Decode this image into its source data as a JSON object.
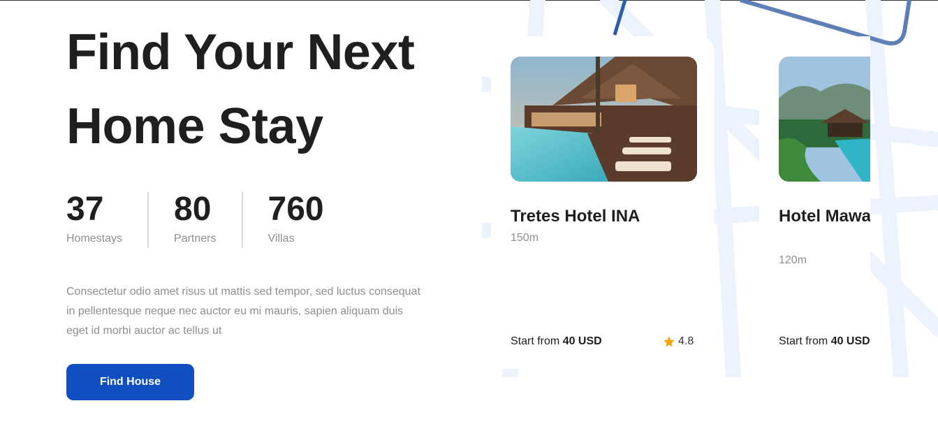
{
  "hero": {
    "title_line1": "Find Your Next",
    "title_line2": "Home Stay",
    "description": "Consectetur odio amet risus ut mattis sed tempor, sed luctus consequat in pellentesque neque nec auctor eu mi mauris, sapien aliquam duis eget id morbi auctor ac tellus ut",
    "cta_label": "Find House"
  },
  "stats": [
    {
      "value": "37",
      "label": "Homestays"
    },
    {
      "value": "80",
      "label": "Partners"
    },
    {
      "value": "760",
      "label": "Villas"
    }
  ],
  "cards": [
    {
      "title": "Tretes Hotel INA",
      "distance": "150m",
      "price_prefix": "Start from",
      "price": "40 USD",
      "rating": "4.8"
    },
    {
      "title": "Hotel Mawar Putih",
      "distance": "120m",
      "price_prefix": "Start from",
      "price": "40 USD"
    }
  ],
  "colors": {
    "primary": "#0f4fbf",
    "star": "#f5a30b",
    "muted": "#8e8e8e",
    "map_line": "#eaf1fb"
  }
}
